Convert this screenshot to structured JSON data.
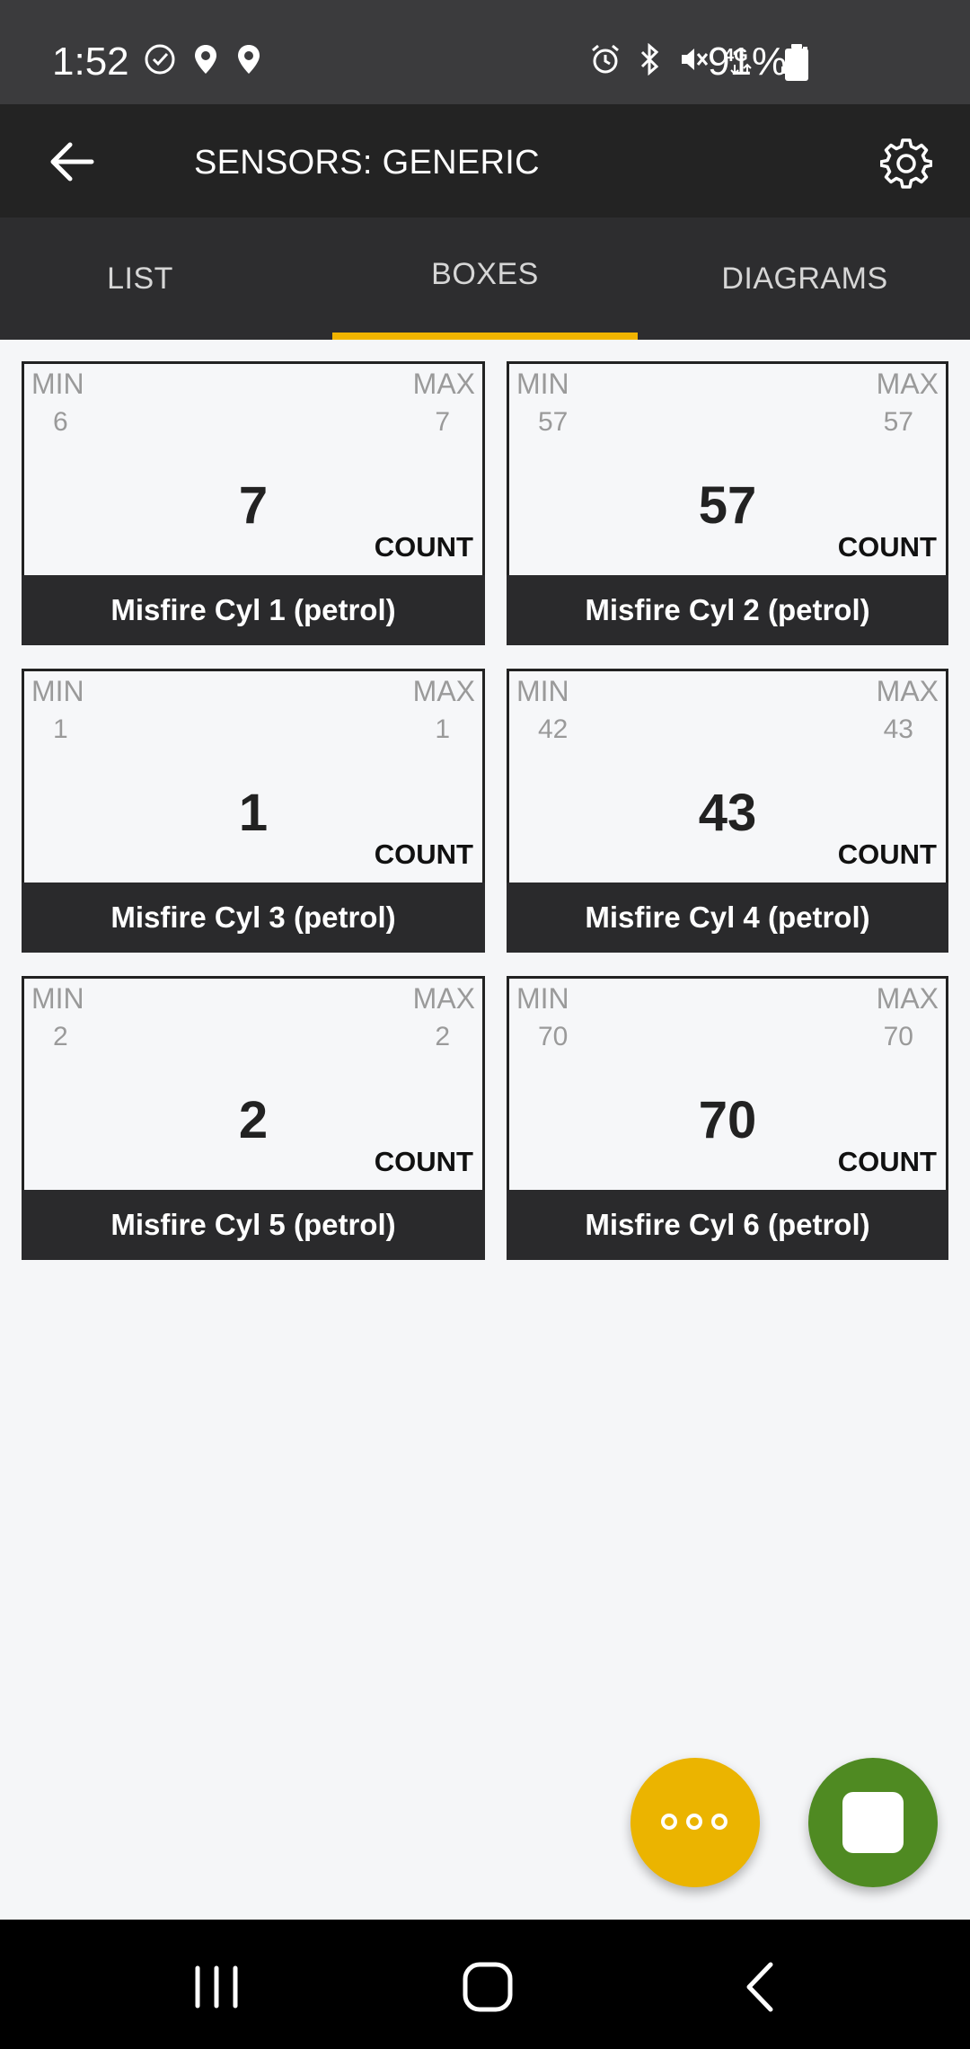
{
  "status_bar": {
    "time": "1:52",
    "battery": "91%",
    "icons": [
      "check-circle-icon",
      "location-icon",
      "location-icon",
      "alarm-icon",
      "bluetooth-icon",
      "mute-icon",
      "4g-icon",
      "signal-icon",
      "battery-icon"
    ]
  },
  "app_bar": {
    "title": "SENSORS: GENERIC"
  },
  "tabs": [
    {
      "label": "LIST",
      "selected": false
    },
    {
      "label": "BOXES",
      "selected": true
    },
    {
      "label": "DIAGRAMS",
      "selected": false
    }
  ],
  "sensors": [
    {
      "min_label": "MIN",
      "max_label": "MAX",
      "min": "6",
      "max": "7",
      "value": "7",
      "unit": "COUNT",
      "name": "Misfire Cyl 1 (petrol)"
    },
    {
      "min_label": "MIN",
      "max_label": "MAX",
      "min": "57",
      "max": "57",
      "value": "57",
      "unit": "COUNT",
      "name": "Misfire Cyl 2 (petrol)"
    },
    {
      "min_label": "MIN",
      "max_label": "MAX",
      "min": "1",
      "max": "1",
      "value": "1",
      "unit": "COUNT",
      "name": "Misfire Cyl 3 (petrol)"
    },
    {
      "min_label": "MIN",
      "max_label": "MAX",
      "min": "42",
      "max": "43",
      "value": "43",
      "unit": "COUNT",
      "name": "Misfire Cyl 4 (petrol)"
    },
    {
      "min_label": "MIN",
      "max_label": "MAX",
      "min": "2",
      "max": "2",
      "value": "2",
      "unit": "COUNT",
      "name": "Misfire Cyl 5 (petrol)"
    },
    {
      "min_label": "MIN",
      "max_label": "MAX",
      "min": "70",
      "max": "70",
      "value": "70",
      "unit": "COUNT",
      "name": "Misfire Cyl 6 (petrol)"
    }
  ],
  "colors": {
    "accent": "#f0b400",
    "fab_more": "#ebb400",
    "fab_stop": "#4f8a22",
    "app_bar": "#232323"
  }
}
